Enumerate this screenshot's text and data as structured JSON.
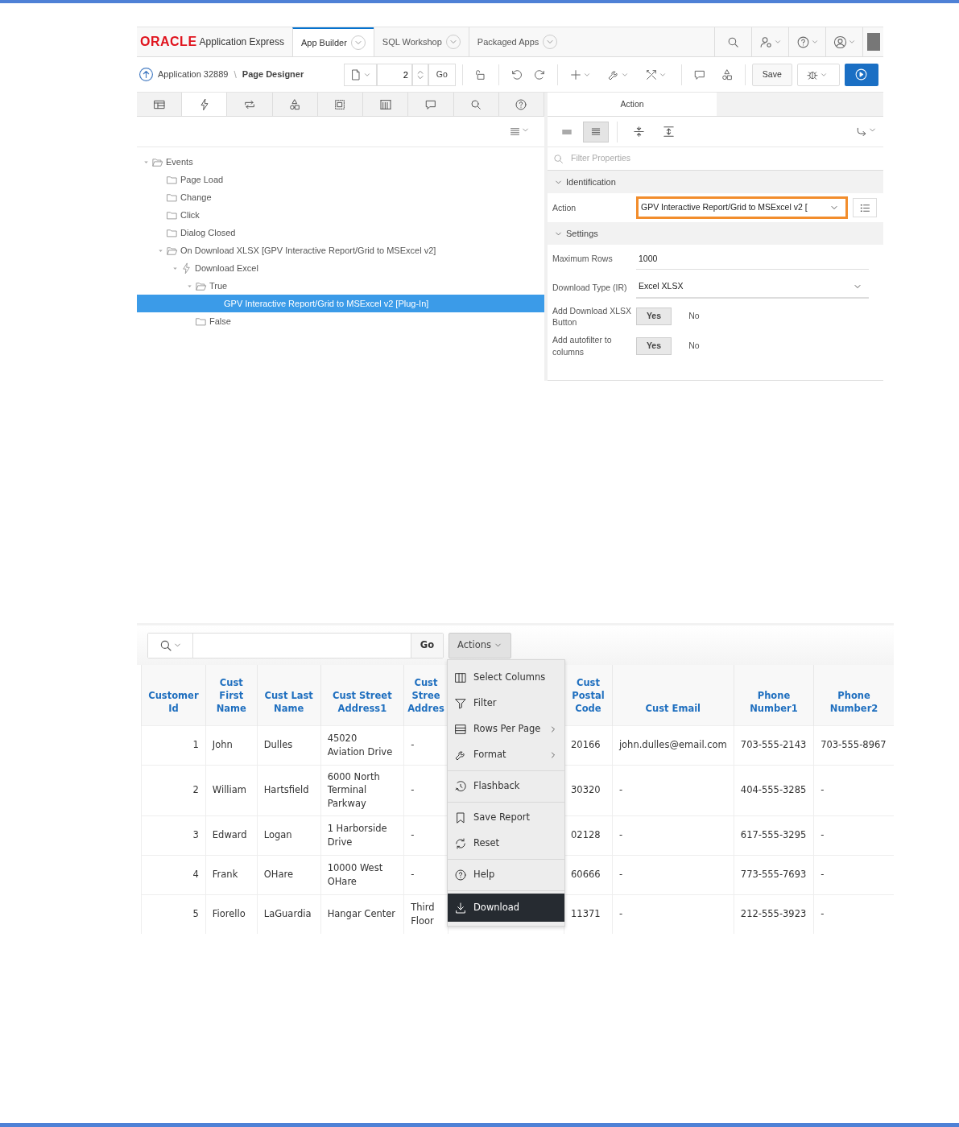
{
  "header": {
    "brand": "ORACLE",
    "product": "Application Express",
    "tabs": [
      {
        "label": "App Builder",
        "selected": true
      },
      {
        "label": "SQL Workshop",
        "selected": false
      },
      {
        "label": "Packaged Apps",
        "selected": false
      }
    ]
  },
  "toolbar": {
    "application": "Application 32889",
    "separator": "\\",
    "page_title": "Page Designer",
    "page_number": "2",
    "go": "Go",
    "save": "Save"
  },
  "component_tabs": [
    {
      "selected": false
    },
    {
      "selected": true
    },
    {
      "selected": false
    },
    {
      "selected": false
    },
    {
      "selected": false
    },
    {
      "selected": false
    },
    {
      "selected": false
    },
    {
      "selected": false
    },
    {
      "selected": false
    }
  ],
  "tree": [
    {
      "label": "Events",
      "kind": "folder",
      "expanded": true,
      "selected": false,
      "children": [
        {
          "label": "Page Load",
          "kind": "folder",
          "expanded": false,
          "selected": false
        },
        {
          "label": "Change",
          "kind": "folder",
          "expanded": false,
          "selected": false
        },
        {
          "label": "Click",
          "kind": "folder",
          "expanded": false,
          "selected": false
        },
        {
          "label": "Dialog Closed",
          "kind": "folder",
          "expanded": false,
          "selected": false
        },
        {
          "label": "On Download XLSX [GPV Interactive Report/Grid to MSExcel v2]",
          "kind": "folder",
          "expanded": true,
          "selected": false,
          "children": [
            {
              "label": "Download Excel",
              "kind": "action",
              "expanded": true,
              "selected": false,
              "children": [
                {
                  "label": "True",
                  "kind": "folder",
                  "expanded": true,
                  "selected": false,
                  "children": [
                    {
                      "label": "GPV Interactive Report/Grid to MSExcel v2 [Plug-In]",
                      "kind": "plugin",
                      "selected": true
                    }
                  ]
                },
                {
                  "label": "False",
                  "kind": "folder",
                  "expanded": false,
                  "selected": false
                }
              ]
            }
          ]
        }
      ]
    }
  ],
  "property_editor": {
    "tab": "Action",
    "view_toggles": [
      {
        "selected": false
      },
      {
        "selected": true
      }
    ],
    "filter_placeholder": "Filter Properties",
    "groups": [
      {
        "title": "Identification",
        "expanded": true,
        "properties": [
          {
            "label": "Action",
            "kind": "select",
            "value": "GPV Interactive Report/Grid to MSExcel v2 [",
            "highlighted": true
          }
        ]
      },
      {
        "title": "Settings",
        "expanded": true,
        "properties": [
          {
            "label": "Maximum Rows",
            "kind": "text",
            "value": "1000"
          },
          {
            "label": "Download Type (IR)",
            "kind": "select",
            "value": "Excel XLSX",
            "highlighted": false
          },
          {
            "label": "Add Download XLSX Button",
            "kind": "yesno",
            "options": [
              {
                "label": "Yes",
                "selected": true
              },
              {
                "label": "No",
                "selected": false
              }
            ]
          },
          {
            "label": "Add autofilter to columns",
            "kind": "yesno",
            "options": [
              {
                "label": "Yes",
                "selected": true
              },
              {
                "label": "No",
                "selected": false
              }
            ]
          }
        ]
      }
    ]
  },
  "report": {
    "go": "Go",
    "actions": "Actions",
    "columns": [
      "Customer Id",
      "Cust First Name",
      "Cust Last Name",
      "Cust Street Address1",
      "Cust Stree Addres",
      "Cust Postal Code",
      "Cust Email",
      "Phone Number1",
      "Phone Number2"
    ],
    "rows": [
      [
        "1",
        "John",
        "Dulles",
        "45020 Aviation Drive",
        "-",
        "20166",
        "john.dulles@email.com",
        "703-555-2143",
        "703-555-8967"
      ],
      [
        "2",
        "William",
        "Hartsfield",
        "6000 North Terminal Parkway",
        "-",
        "30320",
        "-",
        "404-555-3285",
        "-"
      ],
      [
        "3",
        "Edward",
        "Logan",
        "1 Harborside Drive",
        "-",
        "02128",
        "-",
        "617-555-3295",
        "-"
      ],
      [
        "4",
        "Frank",
        "OHare",
        "10000 West OHare",
        "-",
        "60666",
        "-",
        "773-555-7693",
        "-"
      ],
      [
        "5",
        "Fiorello",
        "LaGuardia",
        "Hangar Center",
        "Third Floor",
        "11371",
        "-",
        "212-555-3923",
        "-"
      ]
    ],
    "actions_menu": [
      {
        "label": "Select Columns",
        "submenu": false,
        "separator_before": false,
        "selected": false
      },
      {
        "label": "Filter",
        "submenu": false,
        "separator_before": false,
        "selected": false
      },
      {
        "label": "Rows Per Page",
        "submenu": true,
        "separator_before": false,
        "selected": false
      },
      {
        "label": "Format",
        "submenu": true,
        "separator_before": false,
        "selected": false
      },
      {
        "label": "Flashback",
        "submenu": false,
        "separator_before": true,
        "selected": false
      },
      {
        "label": "Save Report",
        "submenu": false,
        "separator_before": true,
        "selected": false
      },
      {
        "label": "Reset",
        "submenu": false,
        "separator_before": false,
        "selected": false
      },
      {
        "label": "Help",
        "submenu": false,
        "separator_before": true,
        "selected": false
      },
      {
        "label": "Download",
        "submenu": false,
        "separator_before": true,
        "selected": true
      }
    ]
  }
}
